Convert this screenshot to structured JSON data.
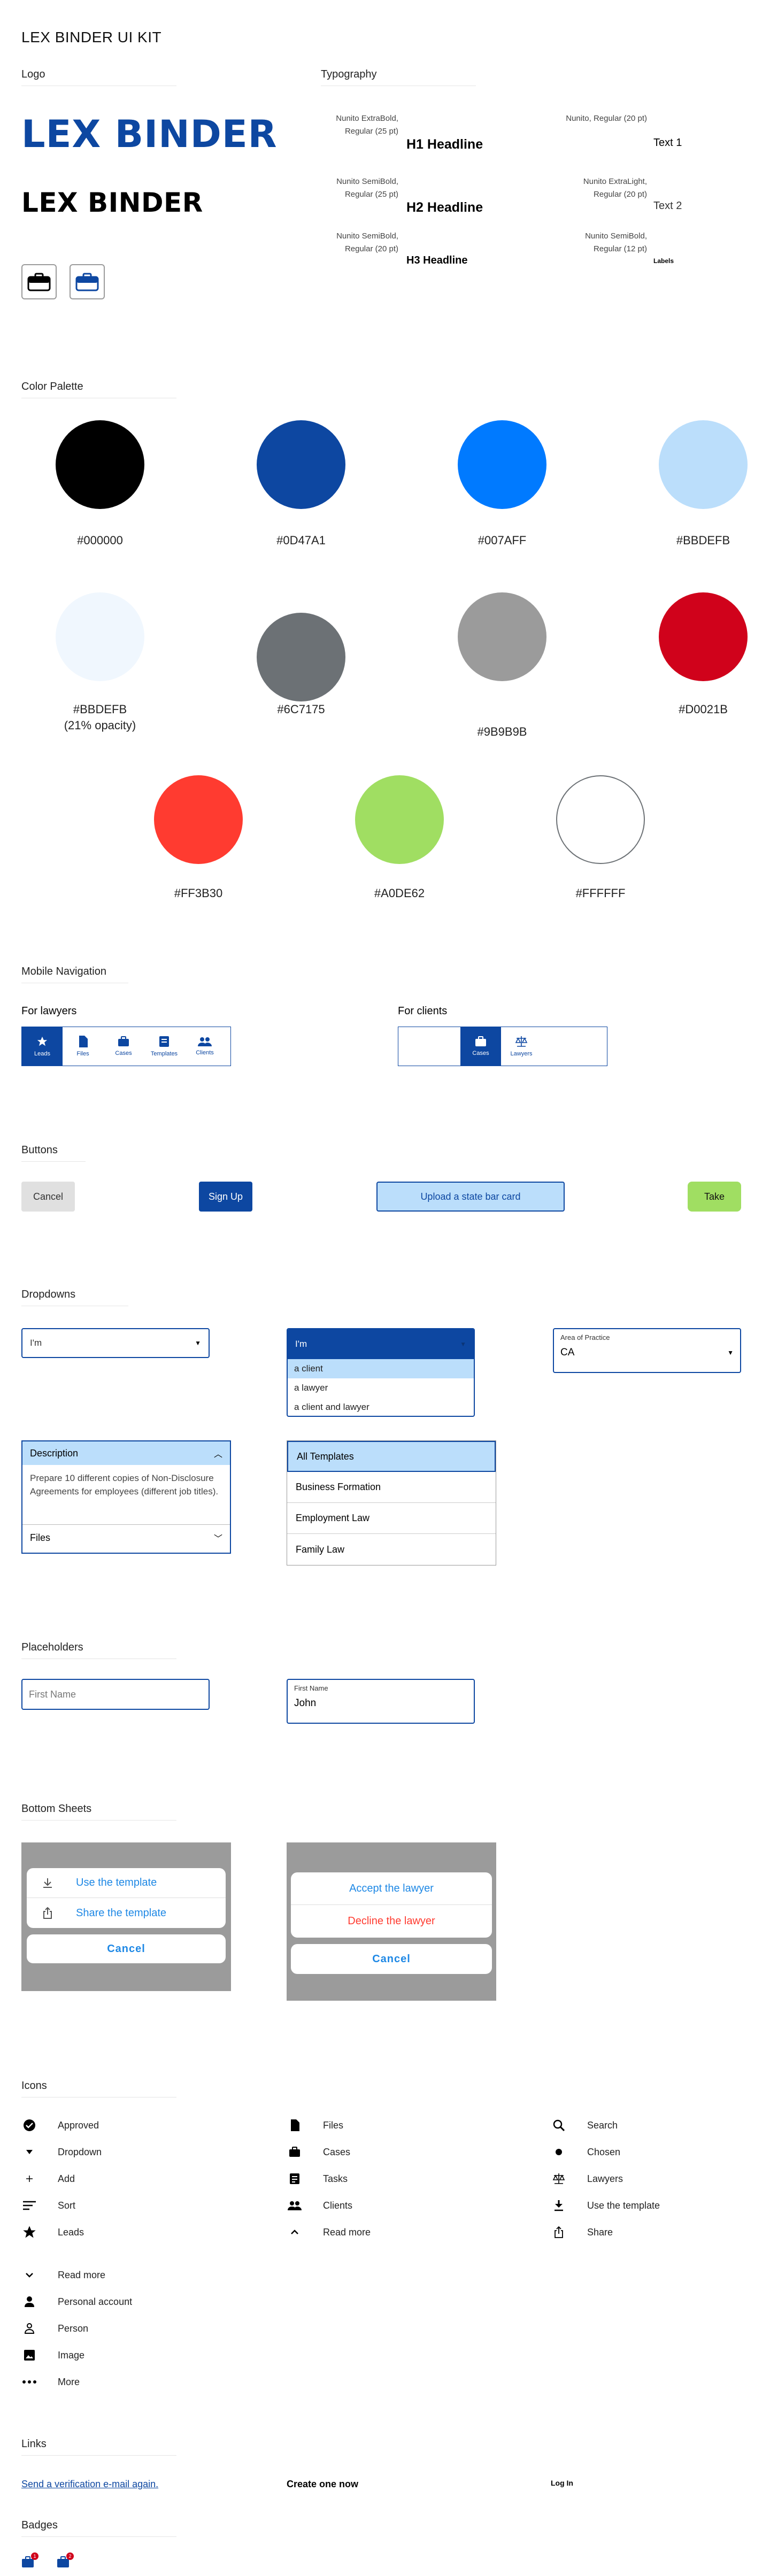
{
  "kit_title": "LEX BINDER UI KIT",
  "sections": {
    "logo": "Logo",
    "typography": "Typography",
    "colors": "Color Palette",
    "mobile_nav": "Mobile Navigation",
    "buttons": "Buttons",
    "dropdowns": "Dropdowns",
    "placeholders": "Placeholders",
    "bottom_sheets": "Bottom Sheets",
    "icons": "Icons",
    "links": "Links",
    "badges": "Badges"
  },
  "logo": {
    "text_blue": "LEX BINDER",
    "text_black": "LEX BINDER",
    "icon_outline": "briefcase-outline-icon",
    "icon_filled": "briefcase-filled-icon"
  },
  "typography": [
    {
      "spec": "Nunito ExtraBold, Regular (25 pt)",
      "sample": "H1 Headline"
    },
    {
      "spec": "Nunito SemiBold, Regular (25 pt)",
      "sample": "H2 Headline"
    },
    {
      "spec": "Nunito SemiBold, Regular (20 pt)",
      "sample": "H3 Headline"
    },
    {
      "spec": "Nunito, Regular (20 pt)",
      "sample": "Text 1"
    },
    {
      "spec": "Nunito ExtraLight, Regular (20 pt)",
      "sample": "Text 2"
    },
    {
      "spec": "Nunito SemiBold, Regular (12 pt)",
      "sample": "Labels"
    }
  ],
  "colors": [
    {
      "hex": "#000000",
      "label": "#000000"
    },
    {
      "hex": "#0D47A1",
      "label": "#0D47A1"
    },
    {
      "hex": "#007AFF",
      "label": "#007AFF"
    },
    {
      "hex": "#BBDEFB",
      "label": "#BBDEFB"
    },
    {
      "hex": "#F0F7FE",
      "label": "#BBDEFB",
      "note": "(21% opacity)"
    },
    {
      "hex": "#6C7175",
      "label": "#6C7175"
    },
    {
      "hex": "#9B9B9B",
      "label": "#9B9B9B"
    },
    {
      "hex": "#D0021B",
      "label": "#D0021B"
    },
    {
      "hex": "#FF3B30",
      "label": "#FF3B30"
    },
    {
      "hex": "#A0DE62",
      "label": "#A0DE62"
    },
    {
      "hex": "#FFFFFF",
      "label": "#FFFFFF"
    }
  ],
  "mobile_nav": {
    "lawyers_title": "For lawyers",
    "clients_title": "For clients",
    "lawyers_items": [
      "Leads",
      "Files",
      "Cases",
      "Templates",
      "Clients"
    ],
    "clients_items": [
      "Cases",
      "Lawyers"
    ]
  },
  "buttons": {
    "cancel": "Cancel",
    "signup": "Sign Up",
    "upload": "Upload a state bar card",
    "take": "Take"
  },
  "dropdowns": {
    "im_closed": "I'm",
    "im_open": "I'm",
    "options": [
      "a client",
      "a lawyer",
      "a client and lawyer"
    ],
    "area_label": "Area of Practice",
    "area_value": "CA",
    "desc_title": "Description",
    "desc_text": "Prepare 10 different copies of Non-Disclosure Agreements for employees (different job titles).",
    "files_label": "Files",
    "templates": [
      "All Templates",
      "Business Formation",
      "Employment Law",
      "Family Law"
    ]
  },
  "placeholders": {
    "empty_placeholder": "First Name",
    "filled_label": "First Name",
    "filled_value": "John"
  },
  "bottom_sheets": {
    "sheet1": [
      "Use the template",
      "Share the template"
    ],
    "sheet1_cancel": "Cancel",
    "sheet2_accept": "Accept the lawyer",
    "sheet2_decline": "Decline the lawyer",
    "sheet2_cancel": "Cancel"
  },
  "icons": {
    "col1": [
      "Approved",
      "Dropdown",
      "Add",
      "Sort",
      "Leads",
      "Read more",
      "Personal account",
      "Person",
      "Image",
      "More"
    ],
    "col2": [
      "Files",
      "Cases",
      "Tasks",
      "Clients",
      "Read more"
    ],
    "col3": [
      "Search",
      "Chosen",
      "Lawyers",
      "Use the template",
      "Share"
    ]
  },
  "links": {
    "verification": "Send a verification e-mail again.",
    "create": "Create one now",
    "login": "Log In"
  },
  "badges": {
    "badge1": "1",
    "badge2": "2"
  },
  "accent": {
    "navy": "#0D47A1",
    "blue": "#1E88E5",
    "red": "#D0021B",
    "green": "#A0DE62"
  }
}
